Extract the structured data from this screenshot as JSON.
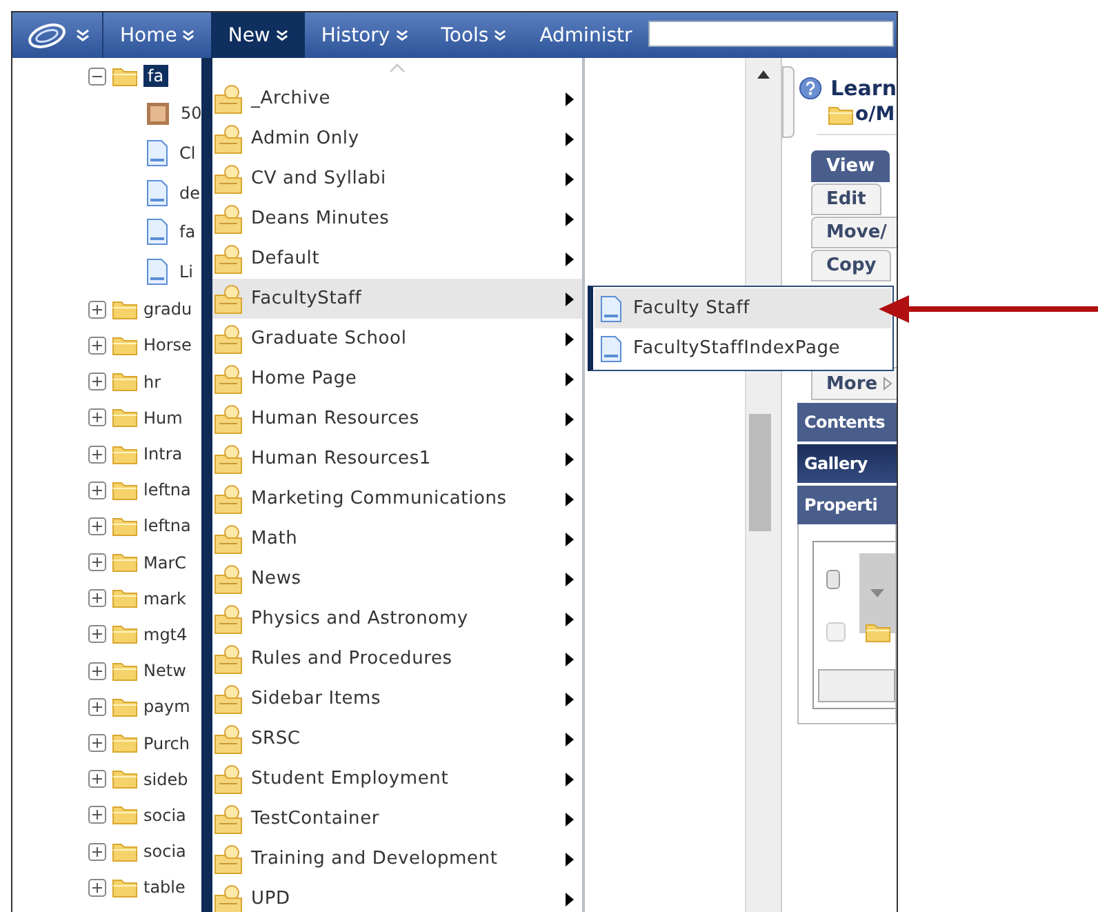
{
  "nav": {
    "items": [
      {
        "label": "Home",
        "selected": false
      },
      {
        "label": "New",
        "selected": true
      },
      {
        "label": "History",
        "selected": false
      },
      {
        "label": "Tools",
        "selected": false
      },
      {
        "label": "Administr",
        "selected": false
      }
    ]
  },
  "tree": {
    "items": [
      {
        "label": "fa",
        "kind": "folder",
        "expanded": true,
        "selected": true,
        "children": [
          {
            "label": "50",
            "kind": "image",
            "selected": false
          },
          {
            "label": "Cl",
            "kind": "page",
            "selected": false
          },
          {
            "label": "de",
            "kind": "page",
            "selected": false
          },
          {
            "label": "fa",
            "kind": "page",
            "selected": false
          },
          {
            "label": "Li",
            "kind": "page",
            "selected": false
          }
        ]
      },
      {
        "label": "gradu",
        "kind": "folder",
        "expanded": false,
        "selected": false
      },
      {
        "label": "Horse",
        "kind": "folder",
        "expanded": false,
        "selected": false
      },
      {
        "label": "hr",
        "kind": "folder",
        "expanded": false,
        "selected": false
      },
      {
        "label": "Hum",
        "kind": "folder",
        "expanded": false,
        "selected": false
      },
      {
        "label": "Intra",
        "kind": "folder",
        "expanded": false,
        "selected": false
      },
      {
        "label": "leftna",
        "kind": "folder",
        "expanded": false,
        "selected": false
      },
      {
        "label": "leftna",
        "kind": "folder",
        "expanded": false,
        "selected": false
      },
      {
        "label": "MarC",
        "kind": "folder",
        "expanded": false,
        "selected": false
      },
      {
        "label": "mark",
        "kind": "folder",
        "expanded": false,
        "selected": false
      },
      {
        "label": "mgt4",
        "kind": "folder",
        "expanded": false,
        "selected": false
      },
      {
        "label": "Netw",
        "kind": "folder",
        "expanded": false,
        "selected": false
      },
      {
        "label": "paym",
        "kind": "folder",
        "expanded": false,
        "selected": false
      },
      {
        "label": "Purch",
        "kind": "folder",
        "expanded": false,
        "selected": false
      },
      {
        "label": "sideb",
        "kind": "folder",
        "expanded": false,
        "selected": false
      },
      {
        "label": "socia",
        "kind": "folder",
        "expanded": false,
        "selected": false
      },
      {
        "label": "socia",
        "kind": "folder",
        "expanded": false,
        "selected": false
      },
      {
        "label": "table",
        "kind": "folder",
        "expanded": false,
        "selected": false
      }
    ]
  },
  "menu": {
    "items": [
      {
        "label": "_Archive",
        "selected": false
      },
      {
        "label": "Admin Only",
        "selected": false
      },
      {
        "label": "CV and Syllabi",
        "selected": false
      },
      {
        "label": "Deans Minutes",
        "selected": false
      },
      {
        "label": "Default",
        "selected": false
      },
      {
        "label": "FacultyStaff",
        "selected": true
      },
      {
        "label": "Graduate School",
        "selected": false
      },
      {
        "label": "Home Page",
        "selected": false
      },
      {
        "label": "Human Resources",
        "selected": false
      },
      {
        "label": "Human Resources1",
        "selected": false
      },
      {
        "label": "Marketing Communications",
        "selected": false
      },
      {
        "label": "Math",
        "selected": false
      },
      {
        "label": "News",
        "selected": false
      },
      {
        "label": "Physics and Astronomy",
        "selected": false
      },
      {
        "label": "Rules and Procedures",
        "selected": false
      },
      {
        "label": "Sidebar Items",
        "selected": false
      },
      {
        "label": "SRSC",
        "selected": false
      },
      {
        "label": "Student Employment",
        "selected": false
      },
      {
        "label": "TestContainer",
        "selected": false
      },
      {
        "label": "Training and Development",
        "selected": false
      },
      {
        "label": "UPD",
        "selected": false
      }
    ]
  },
  "submenu": {
    "items": [
      {
        "label": "Faculty Staff",
        "selected": true
      },
      {
        "label": "FacultyStaffIndexPage",
        "selected": false
      }
    ]
  },
  "panel": {
    "title": "Learn",
    "path": "o/M",
    "actions": [
      {
        "label": "View",
        "selected": true
      },
      {
        "label": "Edit",
        "selected": false
      },
      {
        "label": "Move/",
        "selected": false
      },
      {
        "label": "Copy",
        "selected": false
      }
    ],
    "more": "More",
    "tabs": [
      {
        "label": "Contents",
        "selected": false
      },
      {
        "label": "Gallery",
        "selected": true
      },
      {
        "label": "Properti",
        "selected": false
      }
    ],
    "rows": [
      {
        "checked": false,
        "disabled": false
      },
      {
        "checked": false,
        "disabled": true
      }
    ]
  }
}
